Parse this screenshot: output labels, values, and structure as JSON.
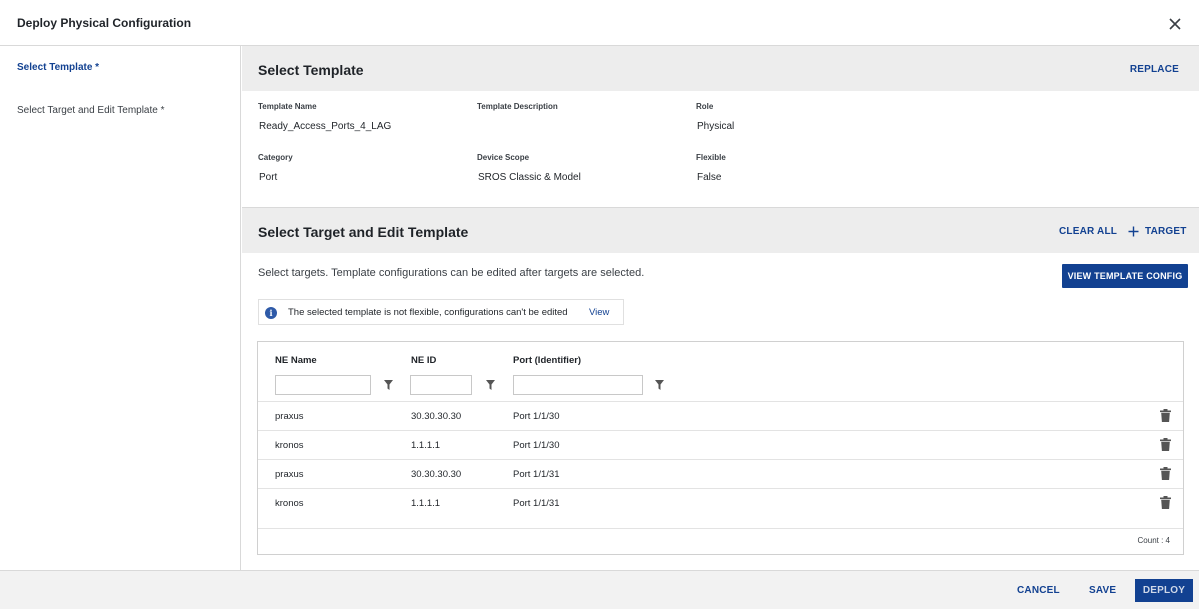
{
  "dialog": {
    "title": "Deploy Physical Configuration"
  },
  "nav": {
    "items": [
      {
        "label": "Select Template *"
      },
      {
        "label": "Select Target and Edit Template *"
      }
    ]
  },
  "select_template": {
    "title": "Select Template",
    "replace_label": "REPLACE",
    "fields": {
      "template_name": {
        "label": "Template Name",
        "value": "Ready_Access_Ports_4_LAG"
      },
      "template_description": {
        "label": "Template Description",
        "value": ""
      },
      "role": {
        "label": "Role",
        "value": "Physical"
      },
      "category": {
        "label": "Category",
        "value": "Port"
      },
      "device_scope": {
        "label": "Device Scope",
        "value": "SROS Classic & Model"
      },
      "flexible": {
        "label": "Flexible",
        "value": "False"
      }
    }
  },
  "select_target": {
    "title": "Select Target and Edit Template",
    "clear_all_label": "CLEAR ALL",
    "add_target_label": "TARGET",
    "instructions": "Select targets. Template configurations can be edited after targets are selected.",
    "view_config_label": "VIEW TEMPLATE CONFIG",
    "info_text": "The selected template is not flexible, configurations can't be edited",
    "info_view_label": "View"
  },
  "table": {
    "columns": [
      "NE Name",
      "NE ID",
      "Port (Identifier)"
    ],
    "rows": [
      {
        "ne_name": "praxus",
        "ne_id": "30.30.30.30",
        "port": "Port 1/1/30"
      },
      {
        "ne_name": "kronos",
        "ne_id": "1.1.1.1",
        "port": "Port 1/1/30"
      },
      {
        "ne_name": "praxus",
        "ne_id": "30.30.30.30",
        "port": "Port 1/1/31"
      },
      {
        "ne_name": "kronos",
        "ne_id": "1.1.1.1",
        "port": "Port 1/1/31"
      }
    ],
    "count_label": "Count : 4"
  },
  "footer": {
    "cancel_label": "CANCEL",
    "save_label": "SAVE",
    "deploy_label": "DEPLOY"
  },
  "colors": {
    "accent": "#124191",
    "header_bg": "#ededed",
    "footer_bg": "#f2f2f2"
  }
}
